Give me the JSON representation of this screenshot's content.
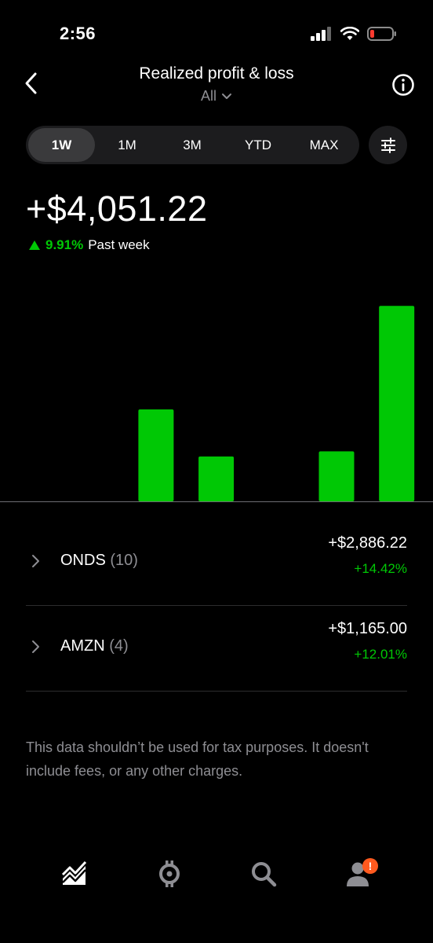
{
  "status": {
    "time": "2:56"
  },
  "nav": {
    "title": "Realized profit & loss",
    "filter_label": "All"
  },
  "range_tabs": [
    {
      "label": "1W",
      "active": true
    },
    {
      "label": "1M",
      "active": false
    },
    {
      "label": "3M",
      "active": false
    },
    {
      "label": "YTD",
      "active": false
    },
    {
      "label": "MAX",
      "active": false
    }
  ],
  "summary": {
    "total": "+$4,051.22",
    "change_pct": "9.91%",
    "change_period": "Past week"
  },
  "chart_data": {
    "type": "bar",
    "values": [
      0,
      0,
      1600,
      780,
      0,
      870,
      3400
    ],
    "ylim": [
      0,
      3500
    ],
    "bar_color": "#00c805"
  },
  "holdings": [
    {
      "symbol": "ONDS",
      "count": "(10)",
      "amount": "+$2,886.22",
      "pct": "+14.42%"
    },
    {
      "symbol": "AMZN",
      "count": "(4)",
      "amount": "+$1,165.00",
      "pct": "+12.01%"
    }
  ],
  "disclaimer": "This data shouldn’t be used for tax purposes. It doesn't include fees, or any other charges.",
  "tabbar": {
    "badge": "!"
  },
  "colors": {
    "accent_green": "#00c805",
    "badge": "#ff5a1f",
    "muted": "#8e8e93"
  }
}
